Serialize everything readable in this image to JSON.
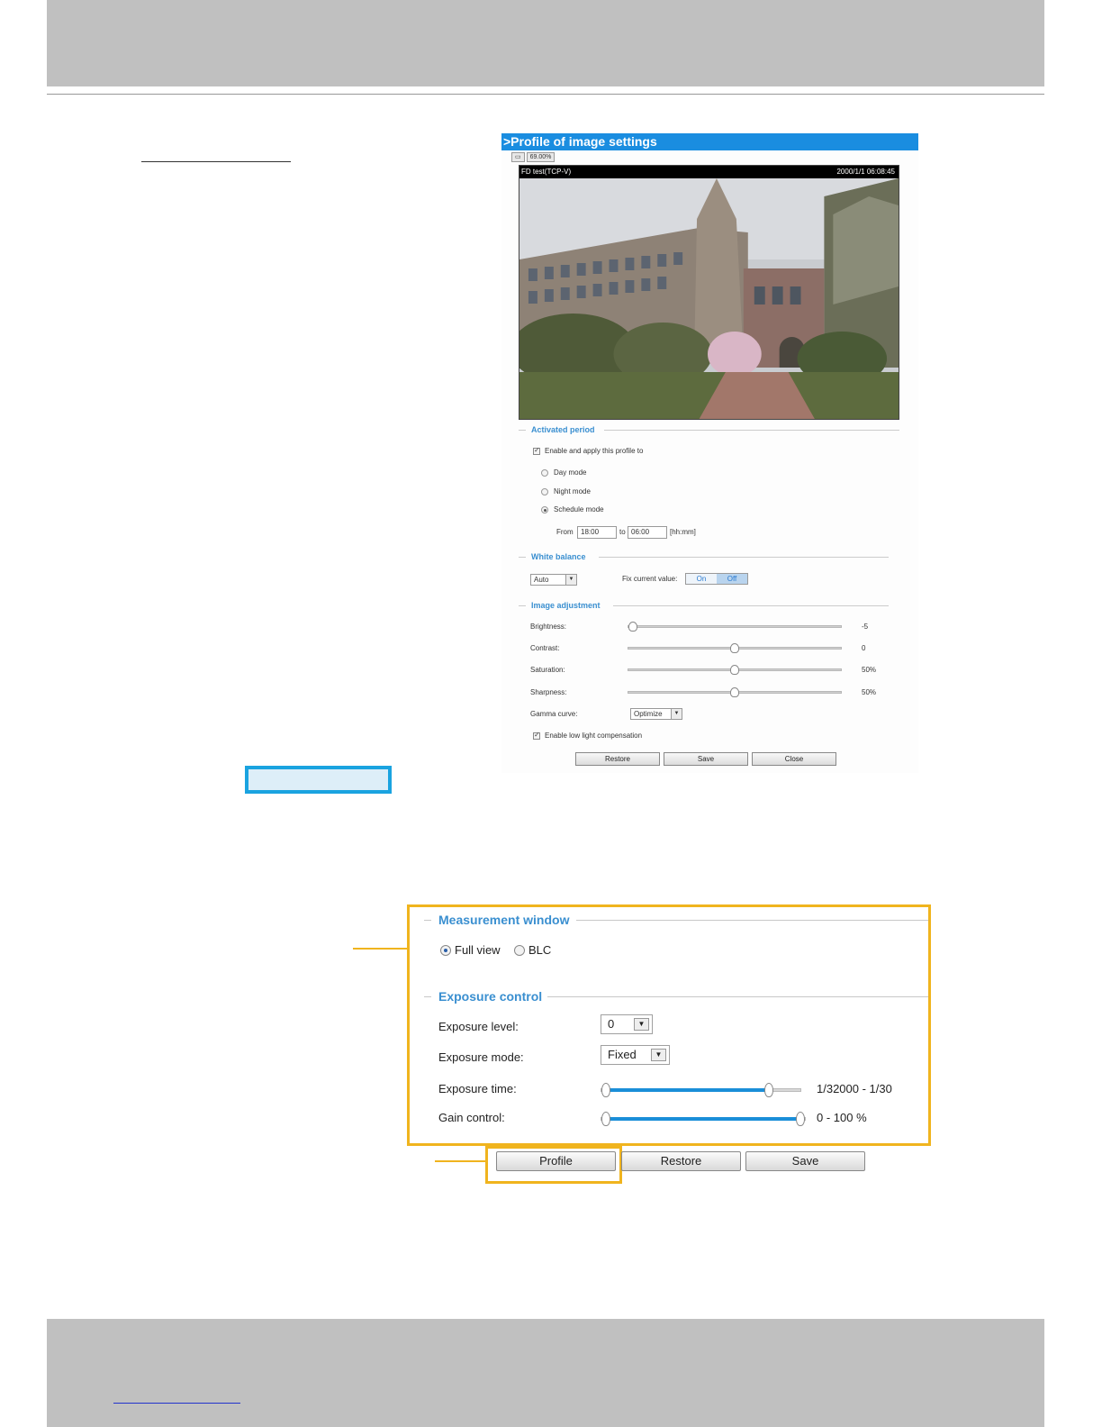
{
  "profile_window": {
    "title": ">Profile of image settings",
    "mini_controls": [
      "▭",
      "69.00%"
    ],
    "video": {
      "camera_label": "FD test(TCP-V)",
      "timestamp": "2000/1/1 06:08:45"
    },
    "activated_period": {
      "title": "Activated period",
      "enable_label": "Enable and apply this profile to",
      "day_mode": "Day mode",
      "night_mode": "Night mode",
      "schedule_mode": "Schedule mode",
      "from_label": "From",
      "from_value": "18:00",
      "to_label": "to",
      "to_value": "06:00",
      "time_format": "[hh:mm]"
    },
    "white_balance": {
      "title": "White balance",
      "mode_value": "Auto",
      "fix_label": "Fix current value:",
      "on_label": "On",
      "off_label": "Off"
    },
    "image_adjustment": {
      "title": "Image adjustment",
      "brightness_label": "Brightness:",
      "brightness_value": "-5",
      "brightness_level": 0.0,
      "contrast_label": "Contrast:",
      "contrast_value": "0",
      "contrast_level": 0.5,
      "saturation_label": "Saturation:",
      "saturation_value": "50%",
      "saturation_level": 0.5,
      "sharpness_label": "Sharpness:",
      "sharpness_value": "50%",
      "sharpness_level": 0.5,
      "gamma_label": "Gamma curve:",
      "gamma_value": "Optimize",
      "low_light_label": "Enable low light compensation"
    },
    "buttons": {
      "restore": "Restore",
      "save": "Save",
      "close": "Close"
    }
  },
  "exposure_panel": {
    "measurement_window_title": "Measurement window",
    "full_view_label": "Full view",
    "blc_label": "BLC",
    "exposure_control_title": "Exposure control",
    "exposure_level_label": "Exposure level:",
    "exposure_level_value": "0",
    "exposure_mode_label": "Exposure mode:",
    "exposure_mode_value": "Fixed",
    "exposure_time_label": "Exposure time:",
    "exposure_time_value": "1/32000 - 1/30",
    "exposure_time_range": [
      0.0,
      0.86
    ],
    "gain_control_label": "Gain control:",
    "gain_control_value": "0 - 100 %",
    "gain_control_range": [
      0.0,
      1.0
    ]
  },
  "bottom_buttons": {
    "profile": "Profile",
    "restore": "Restore",
    "save": "Save"
  },
  "colors": {
    "accent_blue": "#1a8de0",
    "highlight_yellow": "#f0b41e",
    "highlight_cyan": "#1aa3e0",
    "band_gray": "#c0c0c0"
  }
}
